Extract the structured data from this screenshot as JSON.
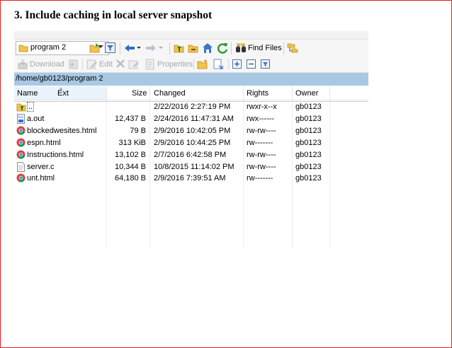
{
  "heading": "3. Include caching in local server snapshot",
  "toolbar": {
    "drive_value": "program 2",
    "find_files_label": "Find Files",
    "download_label": "Download",
    "edit_label": "Edit",
    "properties_label": "Properties"
  },
  "path": "/home/gb0123/program 2",
  "columns": {
    "name": "Name",
    "ext": "Ext",
    "size": "Size",
    "changed": "Changed",
    "rights": "Rights",
    "owner": "Owner"
  },
  "files": [
    {
      "name": "..",
      "icon": "parent-folder-icon",
      "size": "",
      "changed": "2/22/2016 2:27:19 PM",
      "rights": "rwxr-x--x",
      "owner": "gb0123"
    },
    {
      "name": "a.out",
      "icon": "binary-file-icon",
      "size": "12,437 B",
      "changed": "2/24/2016 11:47:31 AM",
      "rights": "rwx------",
      "owner": "gb0123"
    },
    {
      "name": "blockedwesites.html",
      "icon": "chrome-html-icon",
      "size": "79 B",
      "changed": "2/9/2016 10:42:05 PM",
      "rights": "rw-rw----",
      "owner": "gb0123"
    },
    {
      "name": "espn.html",
      "icon": "chrome-html-icon",
      "size": "313 KiB",
      "changed": "2/9/2016 10:44:25 PM",
      "rights": "rw-------",
      "owner": "gb0123"
    },
    {
      "name": "Instructions.html",
      "icon": "chrome-html-icon",
      "size": "13,102 B",
      "changed": "2/7/2016 6:42:58 PM",
      "rights": "rw-rw----",
      "owner": "gb0123"
    },
    {
      "name": "server.c",
      "icon": "text-file-icon",
      "size": "10,344 B",
      "changed": "10/8/2015 11:14:02 PM",
      "rights": "rw-rw----",
      "owner": "gb0123"
    },
    {
      "name": "unt.html",
      "icon": "chrome-html-icon",
      "size": "64,180 B",
      "changed": "2/9/2016 7:39:51 AM",
      "rights": "rw-------",
      "owner": "gb0123"
    }
  ],
  "colors": {
    "frame_border": "#e0201e",
    "path_bar": "#a8c8e4"
  }
}
